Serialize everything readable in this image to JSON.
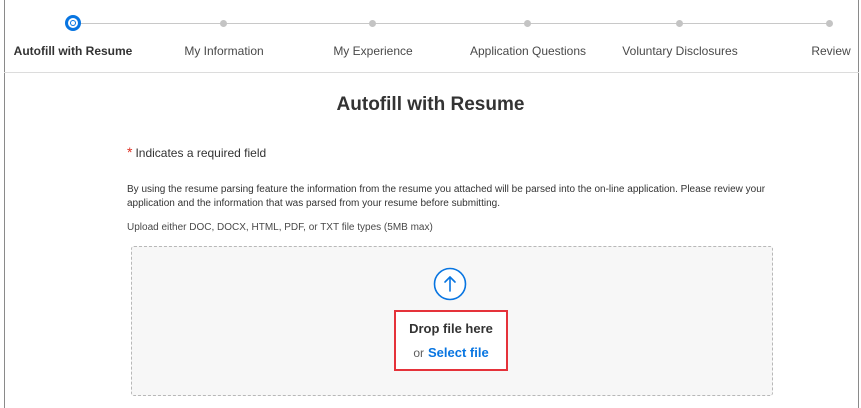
{
  "stepper": {
    "steps": [
      {
        "label": "Autofill with Resume",
        "state": "current"
      },
      {
        "label": "My Information",
        "state": "upcoming"
      },
      {
        "label": "My Experience",
        "state": "upcoming"
      },
      {
        "label": "Application Questions",
        "state": "upcoming"
      },
      {
        "label": "Voluntary Disclosures",
        "state": "upcoming"
      },
      {
        "label": "Review",
        "state": "upcoming"
      }
    ]
  },
  "page": {
    "title": "Autofill with Resume",
    "required_asterisk": "*",
    "required_note": "Indicates a required field",
    "info_text": "By using the resume parsing feature the information from the resume you attached will be parsed into the on-line application. Please review your application and the information that was parsed from your resume before submitting.",
    "filetypes_text": "Upload either DOC, DOCX, HTML, PDF, or TXT file types (5MB max)"
  },
  "dropzone": {
    "icon": "upload-arrow-icon",
    "drop_label": "Drop file here",
    "or_text": "or",
    "select_label": "Select file"
  },
  "colors": {
    "accent": "#0875e1",
    "required": "#de2e21",
    "highlight": "#e5323a"
  }
}
